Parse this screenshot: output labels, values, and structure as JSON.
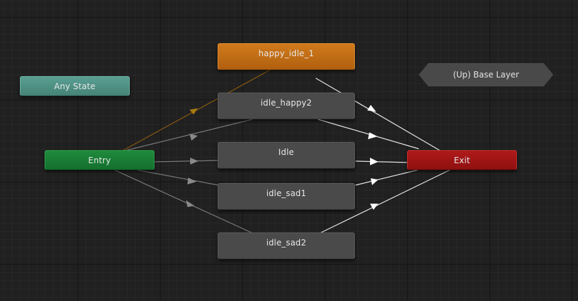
{
  "graph": {
    "layer_button": {
      "label": "(Up) Base Layer"
    },
    "nodes": {
      "any_state": {
        "label": "Any State"
      },
      "entry": {
        "label": "Entry"
      },
      "exit": {
        "label": "Exit"
      },
      "happy_idle_1": {
        "label": "happy_idle_1"
      },
      "idle_happy2": {
        "label": "idle_happy2"
      },
      "idle": {
        "label": "Idle"
      },
      "idle_sad1": {
        "label": "idle_sad1"
      },
      "idle_sad2": {
        "label": "idle_sad2"
      }
    },
    "colors": {
      "canvas": "#202020",
      "state": "#4a4a4a",
      "default_state": "#c8701a",
      "any_state": "#4f9487",
      "entry": "#1a7d35",
      "exit": "#a01515",
      "default_transition": "#8a5a0e",
      "entry_transition": "#7a7a7a",
      "exit_transition": "#e6e6e6"
    }
  }
}
